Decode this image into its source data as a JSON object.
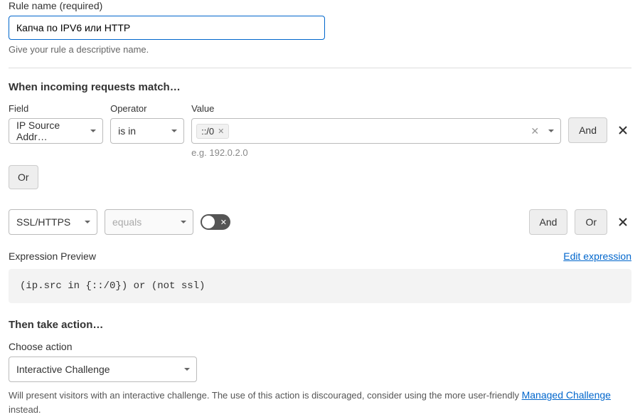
{
  "ruleName": {
    "label": "Rule name (required)",
    "value": "Капча по IPV6 или HTTP",
    "help": "Give your rule a descriptive name."
  },
  "match": {
    "heading": "When incoming requests match…",
    "fieldLabel": "Field",
    "operatorLabel": "Operator",
    "valueLabel": "Value",
    "rows": [
      {
        "field": "IP Source Addr…",
        "operator": "is in",
        "valueTag": "::/0",
        "example": "e.g. 192.0.2.0",
        "and": "And"
      }
    ],
    "or": "Or",
    "row2": {
      "field": "SSL/HTTPS",
      "operator": "equals",
      "and": "And",
      "or": "Or"
    }
  },
  "preview": {
    "label": "Expression Preview",
    "edit": "Edit expression",
    "code": "(ip.src in {::/0}) or (not ssl)"
  },
  "action": {
    "heading": "Then take action…",
    "label": "Choose action",
    "value": "Interactive Challenge",
    "help_prefix": "Will present visitors with an interactive challenge. The use of this action is discouraged, consider using the more user-friendly ",
    "help_link": "Managed Challenge",
    "help_suffix": " instead."
  }
}
